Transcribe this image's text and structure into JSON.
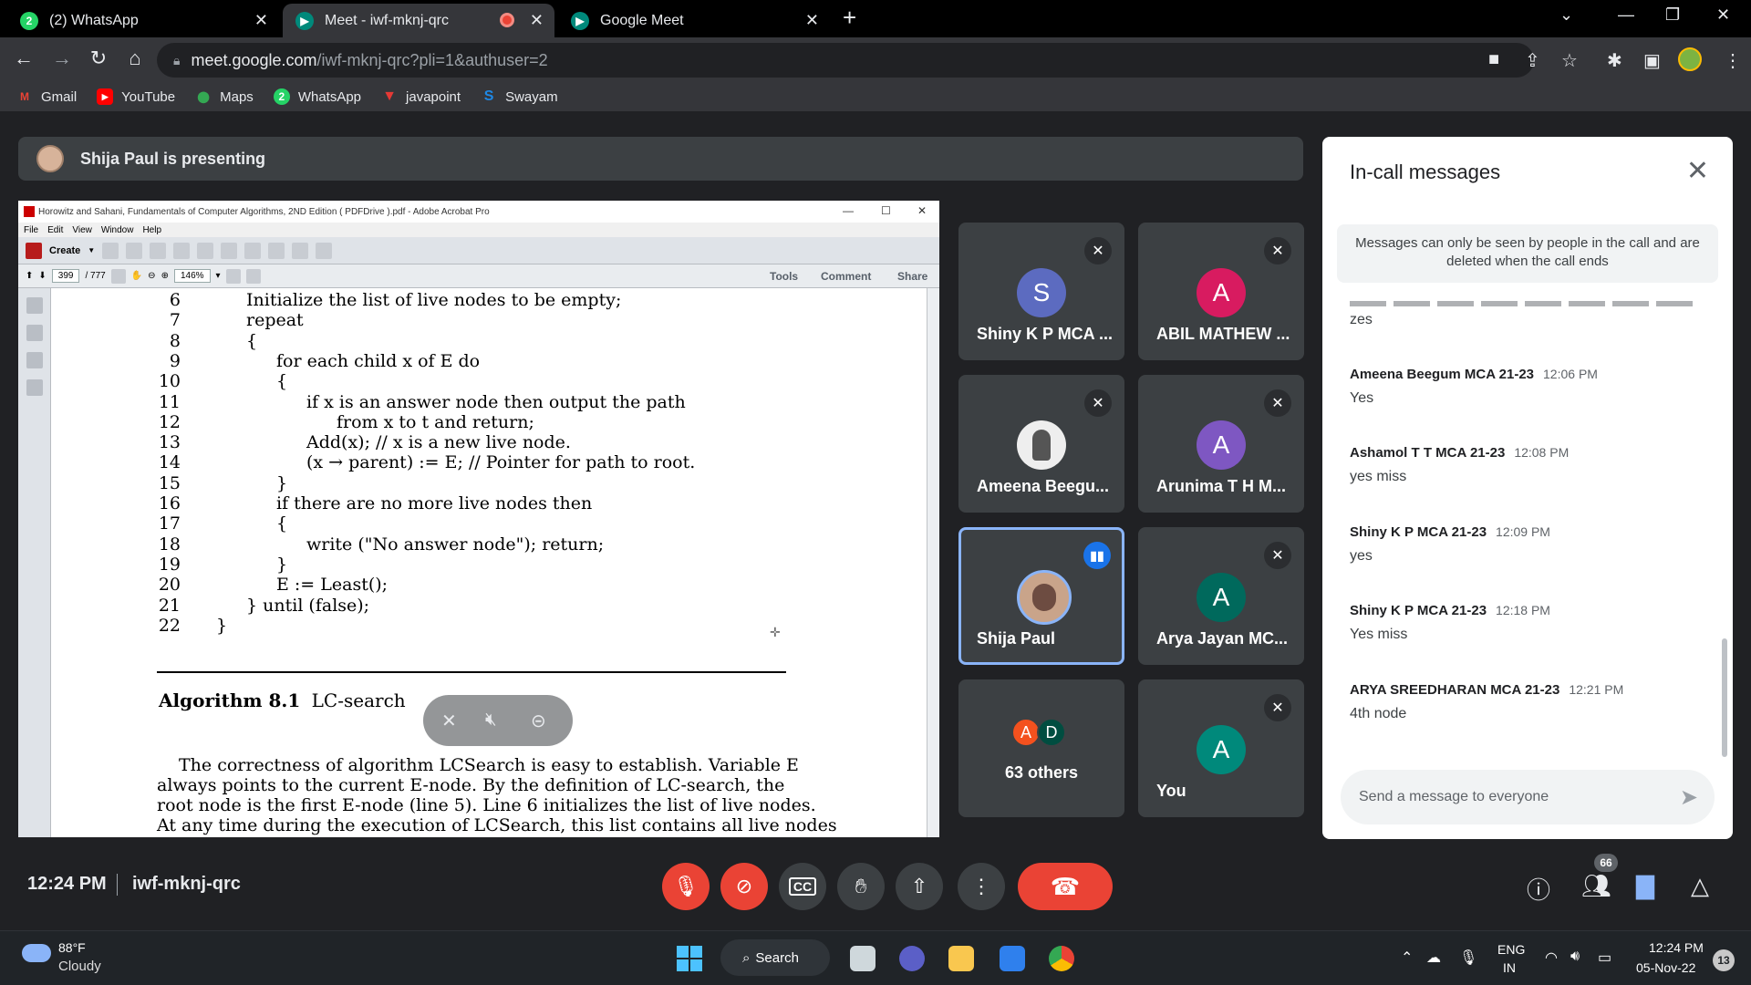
{
  "browser": {
    "tabs": [
      {
        "label": "(2) WhatsApp",
        "icon": "whatsapp-icon"
      },
      {
        "label": "Meet - iwf-mknj-qrc",
        "icon": "meet-icon"
      },
      {
        "label": "Google Meet",
        "icon": "meet-icon"
      }
    ],
    "url_host": "meet.google.com",
    "url_path": "/iwf-mknj-qrc?pli=1&authuser=2",
    "bookmarks": [
      {
        "label": "Gmail",
        "icon": "gmail-icon",
        "color": "#ea4335",
        "glyph": "M"
      },
      {
        "label": "YouTube",
        "icon": "youtube-icon",
        "color": "#ff0000",
        "glyph": "▶"
      },
      {
        "label": "Maps",
        "icon": "maps-icon",
        "color": "#34a853",
        "glyph": "●"
      },
      {
        "label": "WhatsApp",
        "icon": "whatsapp-icon",
        "color": "#25d366",
        "glyph": "2"
      },
      {
        "label": "javapoint",
        "icon": "javapoint-icon",
        "color": "#e53935",
        "glyph": "▼"
      },
      {
        "label": "Swayam",
        "icon": "swayam-icon",
        "color": "#1e88e5",
        "glyph": "S"
      }
    ]
  },
  "meet": {
    "presenting_text": "Shija Paul is presenting",
    "time": "12:24 PM",
    "meeting_code": "iwf-mknj-qrc",
    "people_count": "66",
    "participants": [
      {
        "name": "Shiny K P MCA ...",
        "initial": "S",
        "color": "#5c6bc0",
        "muted": true
      },
      {
        "name": "ABIL MATHEW ...",
        "initial": "A",
        "color": "#d81b60",
        "muted": true
      },
      {
        "name": "Ameena Beegu...",
        "initial": "",
        "color": "#eeeeee",
        "muted": true
      },
      {
        "name": "Arunima T H M...",
        "initial": "A",
        "color": "#7e57c2",
        "muted": true
      },
      {
        "name": "Shija Paul",
        "initial": "",
        "color": "#c9a48a",
        "muted": false,
        "speaking": true
      },
      {
        "name": "Arya Jayan MC...",
        "initial": "A",
        "color": "#00695c",
        "muted": true
      },
      {
        "name": "63 others",
        "initial": "",
        "color": "#3c4043",
        "muted": false,
        "others": [
          "A",
          "D"
        ]
      },
      {
        "name": "You",
        "initial": "A",
        "color": "#00897b",
        "muted": true
      }
    ]
  },
  "chat": {
    "title": "In-call messages",
    "note": "Messages can only be seen by people in the call and are deleted when the call ends",
    "partial_body": "zes",
    "messages": [
      {
        "sender": "Ameena Beegum MCA 21-23",
        "time": "12:06 PM",
        "body": "Yes"
      },
      {
        "sender": "Ashamol T T MCA 21-23",
        "time": "12:08 PM",
        "body": "yes miss"
      },
      {
        "sender": "Shiny K P MCA 21-23",
        "time": "12:09 PM",
        "body": "yes"
      },
      {
        "sender": "Shiny K P MCA 21-23",
        "time": "12:18 PM",
        "body": "Yes miss"
      },
      {
        "sender": "ARYA SREEDHARAN MCA 21-23",
        "time": "12:21 PM",
        "body": "4th node"
      }
    ],
    "input_placeholder": "Send a message to everyone"
  },
  "acrobat": {
    "title": "Horowitz and Sahani, Fundamentals of Computer Algorithms, 2ND Edition ( PDFDrive ).pdf - Adobe Acrobat Pro",
    "menu": [
      "File",
      "Edit",
      "View",
      "Window",
      "Help"
    ],
    "create_label": "Create",
    "page_current": "399",
    "page_total": "/ 777",
    "zoom": "146%",
    "right_links": [
      "Tools",
      "Comment",
      "Share"
    ],
    "code": [
      {
        "n": "6",
        "indent": 0,
        "text": "Initialize the list of live nodes to be empty;"
      },
      {
        "n": "7",
        "indent": 0,
        "text": "repeat"
      },
      {
        "n": "8",
        "indent": 0,
        "text": "{"
      },
      {
        "n": "9",
        "indent": 1,
        "text": "for each child x of E do"
      },
      {
        "n": "10",
        "indent": 1,
        "text": "{"
      },
      {
        "n": "11",
        "indent": 2,
        "text": "if x is an answer node then output the path"
      },
      {
        "n": "12",
        "indent": 3,
        "text": "from x to t and return;"
      },
      {
        "n": "13",
        "indent": 2,
        "text": "Add(x); // x is a new live node."
      },
      {
        "n": "14",
        "indent": 2,
        "text": "(x → parent) := E; // Pointer for path to root."
      },
      {
        "n": "15",
        "indent": 1,
        "text": "}"
      },
      {
        "n": "16",
        "indent": 1,
        "text": "if there are no more live nodes then"
      },
      {
        "n": "17",
        "indent": 1,
        "text": "{"
      },
      {
        "n": "18",
        "indent": 2,
        "text": "write (\"No answer node\"); return;"
      },
      {
        "n": "19",
        "indent": 1,
        "text": "}"
      },
      {
        "n": "20",
        "indent": 1,
        "text": "E := Least();"
      },
      {
        "n": "21",
        "indent": 0,
        "text": "} until (false);"
      },
      {
        "n": "22",
        "indent": -1,
        "text": "}"
      }
    ],
    "algo_caption_bold": "Algorithm 8.1",
    "algo_caption": "LC-search",
    "paragraph": [
      "The correctness of algorithm LCSearch is easy to establish. Variable E",
      "always points to the current E-node. By the definition of LC-search, the",
      "root node is the first E-node (line 5). Line 6 initializes the list of live nodes.",
      "At any time during the execution of LCSearch, this list contains all live nodes"
    ]
  },
  "taskbar": {
    "temp": "88°F",
    "weather": "Cloudy",
    "search_label": "Search",
    "lang_top": "ENG",
    "lang_bottom": "IN",
    "time": "12:24 PM",
    "date": "05-Nov-22",
    "notifications": "13"
  }
}
